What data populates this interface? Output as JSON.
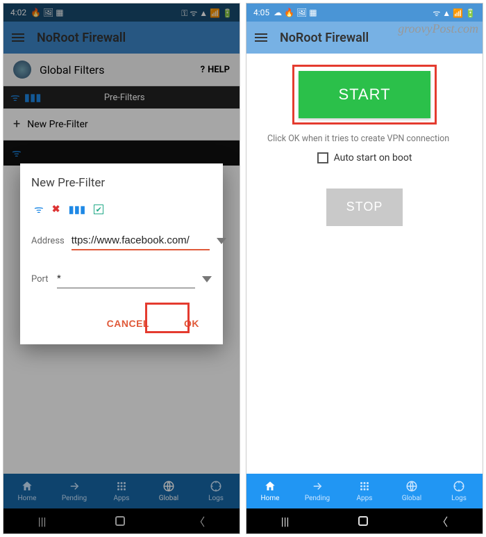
{
  "watermark": "groovyPost.com",
  "left": {
    "status": {
      "time": "4:02",
      "icons_left": "🔥 🖼 ▦",
      "icons_right": "⚿ ᯤ ▲ 📶 🔋"
    },
    "app_title": "NoRoot Firewall",
    "section_label": "Global Filters",
    "help_label": "HELP",
    "tab_label": "Pre-Filters",
    "new_filter_label": "New Pre-Filter",
    "dialog": {
      "title": "New Pre-Filter",
      "address_label": "Address",
      "address_value": "ttps://www.facebook.com/",
      "port_label": "Port",
      "port_value": "*",
      "cancel": "CANCEL",
      "ok": "OK"
    },
    "nav": {
      "home": "Home",
      "pending": "Pending",
      "apps": "Apps",
      "global": "Global",
      "logs": "Logs"
    }
  },
  "right": {
    "status": {
      "time": "4:05",
      "icons_left": "☁ 🔥 🖼 ▦",
      "icons_right": "ᯤ ▲ 📶 🔋"
    },
    "app_title": "NoRoot Firewall",
    "start_label": "START",
    "hint": "Click OK when it tries to create VPN connection",
    "auto_start_label": "Auto start on boot",
    "stop_label": "STOP",
    "nav": {
      "home": "Home",
      "pending": "Pending",
      "apps": "Apps",
      "global": "Global",
      "logs": "Logs"
    }
  }
}
